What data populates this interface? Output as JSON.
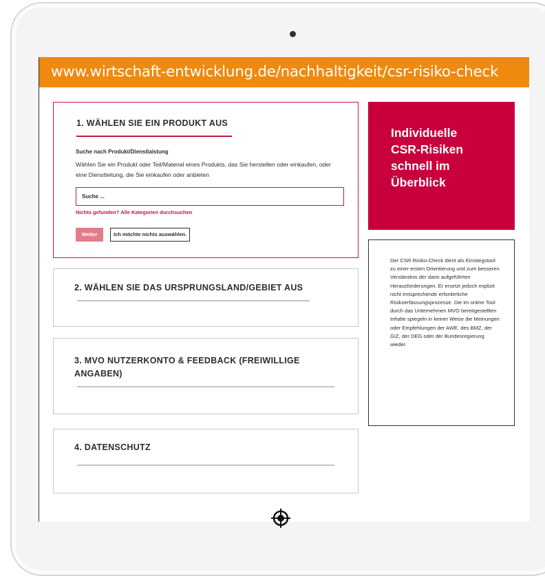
{
  "url": "www.wirtschaft-entwicklung.de/nachhaltigkeit/csr-risiko-check",
  "steps": [
    {
      "title": "1. WÄHLEN SIE EIN PRODUKT AUS"
    },
    {
      "title": "2. WÄHLEN SIE DAS URSPRUNGSLAND/GEBIET AUS"
    },
    {
      "title": "3. MVO NUTZERKONTO & FEEDBACK (FREIWILLIGE ANGABEN)"
    },
    {
      "title": "4. DATENSCHUTZ"
    }
  ],
  "search": {
    "label": "Suche nach Produkt/Dienstlaistung",
    "description": "Wählen Sie ein Produkt oder Teil/Material eines Produkts, das Sie herstellen oder einkaufen, oder eine Dienstleitung, die Sie einkaufen oder anbieten",
    "placeholder": "Suche ...",
    "not_found_link": "Nichts gefunden? Alle Kategorien durchsuchen"
  },
  "buttons": {
    "next": "Weiter",
    "skip": "Ich möchte nichts auswählen."
  },
  "promo": {
    "text": "Individuelle\nCSR-Risiken\nschnell im\nÜberblick"
  },
  "info": {
    "text": "Der CSR Risiko-Check dient als Einstiegstool zu einer ersten Orientierung und zum besseren Verständnis der darin aufgeführten Herausforderungen. Er ersetzt jedoch explizit nicht entsprechende erforderliche Risikoerfassungsprozesse. Die im online Tool durch das Unternehmen MVO bereitgestellten Inhalte spiegeln in keiner Weise die Meinungen oder Empfehlungen der AWE, des BMZ, der GIZ, der DEG oder der Bundesregierung wieder."
  },
  "colors": {
    "url_bar": "#ee8a10",
    "accent": "#c8153d",
    "promo_bg": "#c8003c",
    "next_button": "#e07d89"
  }
}
